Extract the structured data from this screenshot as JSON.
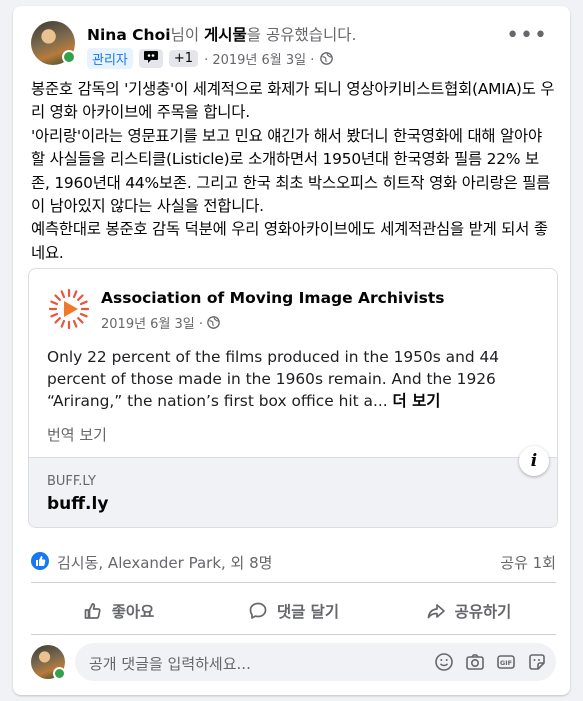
{
  "post": {
    "author": "Nina Choi",
    "action_prefix": "님이 ",
    "action_object": "게시물",
    "action_suffix": "을 공유했습니다.",
    "role_badge": "관리자",
    "extra_badge": "+1",
    "date": "· 2019년 6월 3일 ·",
    "body": "봉준호 감독의 '기생충'이 세계적으로 화제가 되니 영상아키비스트협회(AMIA)도 우리 영화 아카이브에 주목을 합니다.\n'아리랑'이라는 영문표기를 보고 민요 얘긴가 해서 봤더니 한국영화에 대해 알아야 할 사실들을 리스티클(Listicle)로 소개하면서 1950년대 한국영화 필름 22% 보존, 1960년대 44%보존. 그리고 한국 최초 박스오피스 히트작 영화 아리랑은 필름이 남아있지 않다는 사실을 전합니다.\n예측한대로 봉준호 감독 덕분에 우리 영화아카이브에도 세계적관심을 받게 되서 좋네요."
  },
  "shared": {
    "page_name": "Association of Moving Image Archivists",
    "date": "2019년 6월 3일 ·",
    "text": "Only 22 percent of the films produced in the 1950s and 44 percent of those made in the 1960s remain. And the 1926 “Arirang,” the nation’s first box office hit a... ",
    "see_more": "더 보기",
    "translate": "번역 보기",
    "link_domain": "BUFF.LY",
    "link_title": "buff.ly",
    "info_label": "i"
  },
  "reactions": {
    "names": "김시동, Alexander Park, 외 8명",
    "shares": "공유 1회"
  },
  "actions": {
    "like": "좋아요",
    "comment": "댓글 달기",
    "share": "공유하기"
  },
  "comment": {
    "placeholder": "공개 댓글을 입력하세요..."
  },
  "colors": {
    "accent": "#1877f2",
    "online": "#31a24c",
    "muted": "#65676b"
  }
}
